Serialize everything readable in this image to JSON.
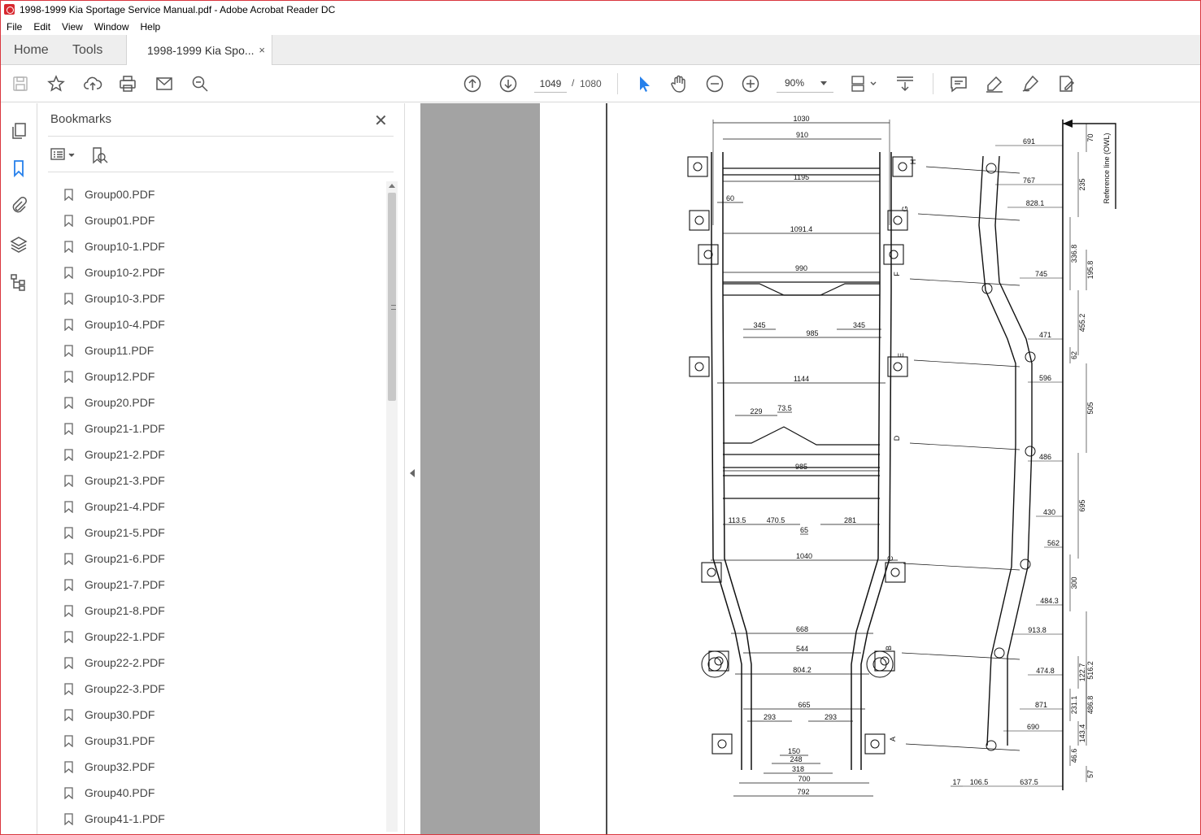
{
  "window": {
    "title": "1998-1999 Kia Sportage Service Manual.pdf - Adobe Acrobat Reader DC"
  },
  "menu": [
    "File",
    "Edit",
    "View",
    "Window",
    "Help"
  ],
  "tabs": {
    "home": "Home",
    "tools": "Tools",
    "document": "1998-1999 Kia Spo...",
    "close": "×"
  },
  "toolbar": {
    "page_current": "1049",
    "page_separator": "/",
    "page_total": "1080",
    "zoom": "90%",
    "icons": [
      "save-icon",
      "star-icon",
      "upload-icon",
      "print-icon",
      "email-icon",
      "search-icon",
      "prev-page-icon",
      "next-page-icon",
      "select-cursor-icon",
      "hand-icon",
      "zoom-out-icon",
      "zoom-in-icon",
      "page-fit-icon",
      "scroll-mode-icon",
      "comment-icon",
      "highlight-icon",
      "sign-icon",
      "edit-pdf-icon"
    ]
  },
  "rail": [
    "pages-icon",
    "bookmark-icon",
    "attachment-icon",
    "layers-icon",
    "structure-icon"
  ],
  "bookmarks": {
    "title": "Bookmarks",
    "close": "✕",
    "items": [
      "Group00.PDF",
      "Group01.PDF",
      "Group10-1.PDF",
      "Group10-2.PDF",
      "Group10-3.PDF",
      "Group10-4.PDF",
      "Group11.PDF",
      "Group12.PDF",
      "Group20.PDF",
      "Group21-1.PDF",
      "Group21-2.PDF",
      "Group21-3.PDF",
      "Group21-4.PDF",
      "Group21-5.PDF",
      "Group21-6.PDF",
      "Group21-7.PDF",
      "Group21-8.PDF",
      "Group22-1.PDF",
      "Group22-2.PDF",
      "Group22-3.PDF",
      "Group30.PDF",
      "Group31.PDF",
      "Group32.PDF",
      "Group40.PDF",
      "Group41-1.PDF"
    ]
  },
  "drawing": {
    "top_dims": [
      "1030",
      "910",
      "1195",
      "60",
      "1091.4",
      "990",
      "345",
      "345",
      "985",
      "1144",
      "229",
      "73.5",
      "985",
      "113.5",
      "470.5",
      "65",
      "281",
      "1040",
      "668",
      "544",
      "804.2",
      "665",
      "293",
      "293",
      "150",
      "248",
      "318",
      "700",
      "792"
    ],
    "side_dims": [
      "691",
      "70",
      "767",
      "235",
      "828.1",
      "336.8",
      "195.8",
      "745",
      "455.2",
      "471",
      "62",
      "596",
      "505",
      "486",
      "695",
      "430",
      "562",
      "300",
      "484.3",
      "516.2",
      "913.8",
      "474.8",
      "122.7",
      "231.1",
      "486.8",
      "871",
      "690",
      "143.4",
      "46.6",
      "57",
      "17",
      "106.5",
      "637.5"
    ],
    "section_labels": [
      "H",
      "G",
      "F",
      "E",
      "D",
      "C",
      "B",
      "A"
    ],
    "reference_label": "Reference line (OWL)"
  }
}
